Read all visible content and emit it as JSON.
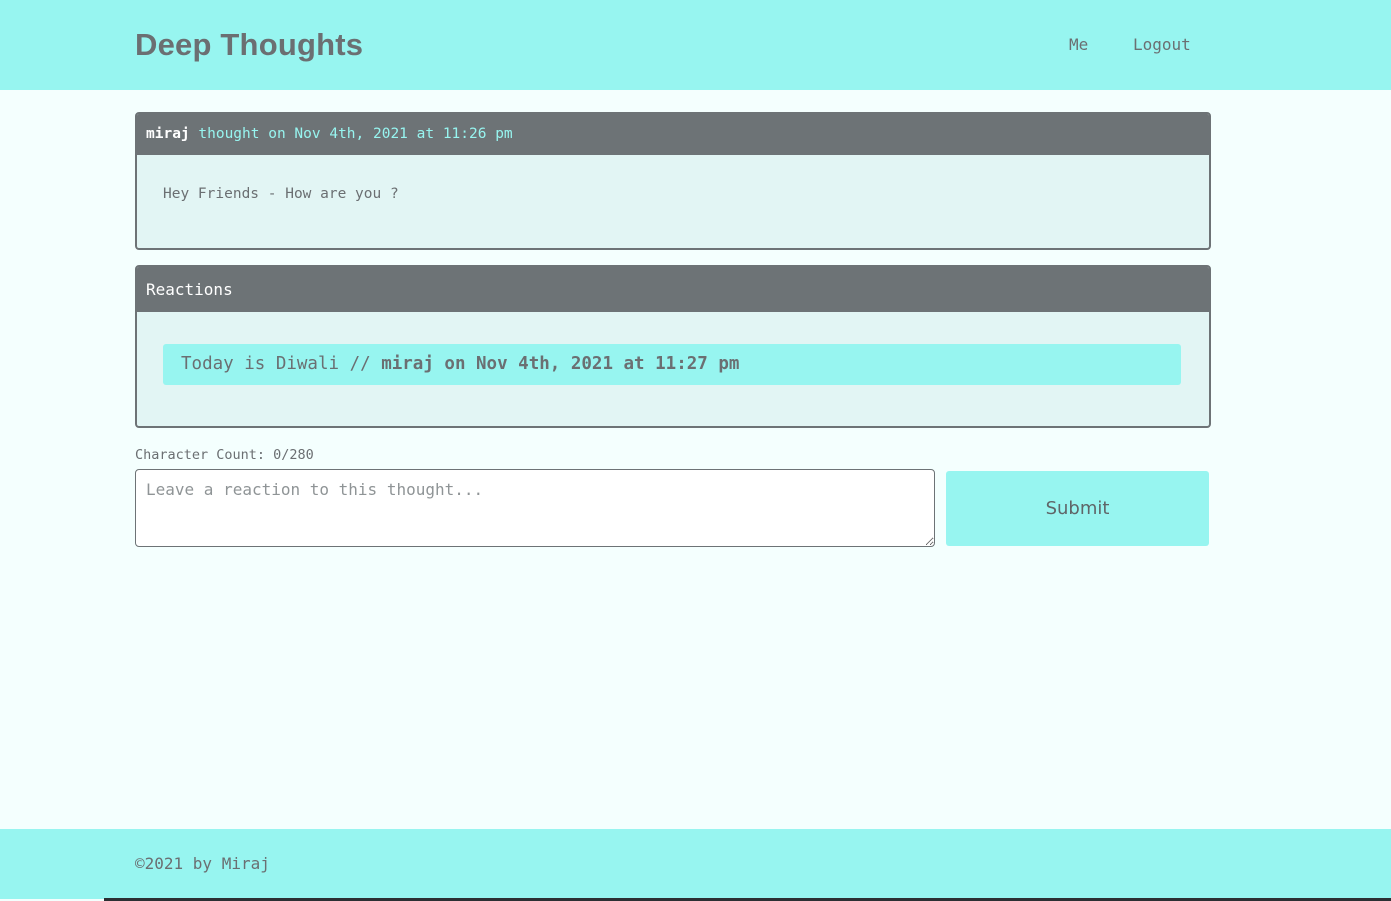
{
  "header": {
    "title": "Deep Thoughts",
    "nav": {
      "me": "Me",
      "logout": "Logout"
    }
  },
  "thought": {
    "author": "miraj",
    "meta": "thought on Nov 4th, 2021 at 11:26 pm",
    "body": "Hey Friends - How are you ?"
  },
  "reactions": {
    "heading": "Reactions",
    "items": [
      {
        "body": "Today is Diwali // ",
        "byline": "miraj on Nov 4th, 2021 at 11:27 pm"
      }
    ]
  },
  "reaction_form": {
    "char_count": "Character Count: 0/280",
    "placeholder": "Leave a reaction to this thought...",
    "submit_label": "Submit"
  },
  "footer": {
    "text": "©2021 by Miraj"
  },
  "colors": {
    "accent": "#97f5f0",
    "card_header": "#6d7376",
    "text": "#6b6f72",
    "page_background": "#f4fffe"
  }
}
